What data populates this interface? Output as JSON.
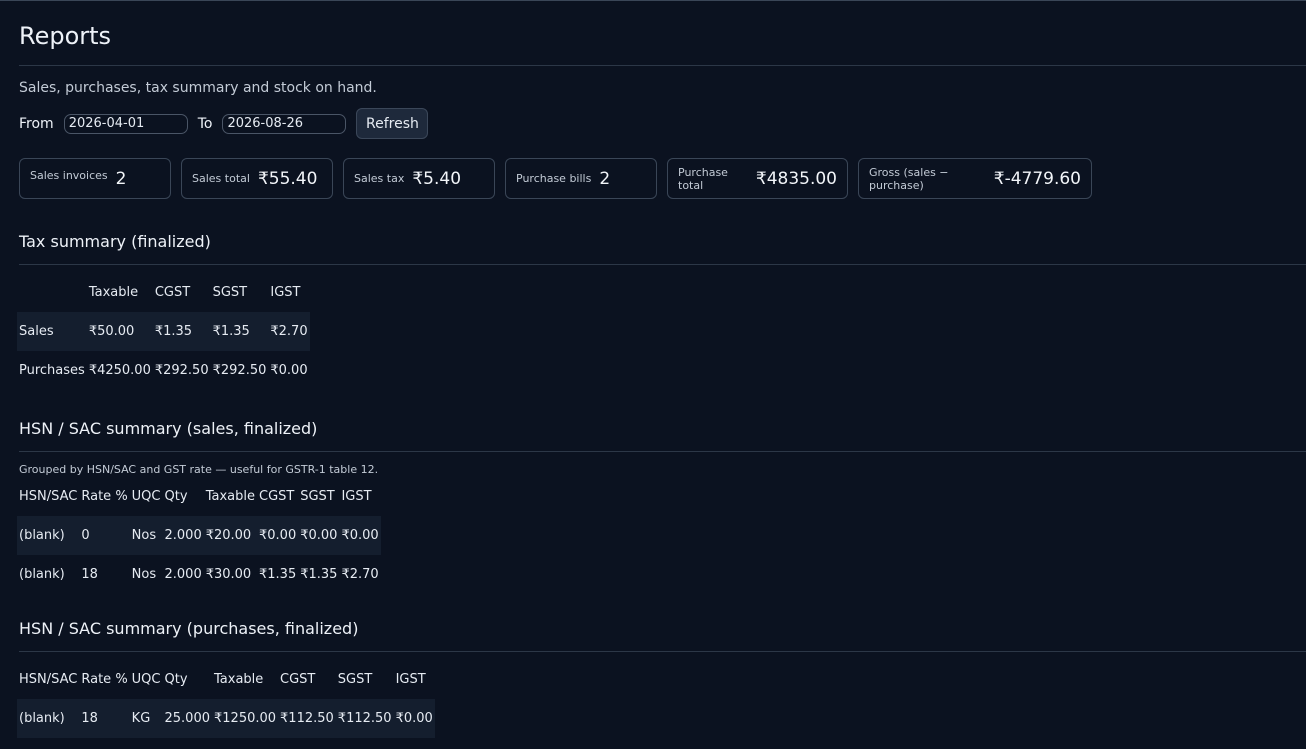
{
  "page": {
    "title": "Reports",
    "subtitle": "Sales, purchases, tax summary and stock on hand."
  },
  "filters": {
    "from_label": "From",
    "from_value": "2026-04-01",
    "to_label": "To",
    "to_value": "2026-08-26",
    "refresh_label": "Refresh"
  },
  "cards": [
    {
      "label": "Sales invoices",
      "value": "2"
    },
    {
      "label": "Sales total",
      "value": "₹55.40"
    },
    {
      "label": "Sales tax",
      "value": "₹5.40"
    },
    {
      "label": "Purchase bills",
      "value": "2"
    },
    {
      "label": "Purchase total",
      "value": "₹4835.00"
    },
    {
      "label": "Gross (sales − purchase)",
      "value": "₹-4779.60"
    }
  ],
  "tax_summary": {
    "title": "Tax summary (finalized)",
    "headers": [
      "",
      "Taxable",
      "CGST",
      "SGST",
      "IGST"
    ],
    "rows": [
      [
        "Sales",
        "₹50.00",
        "₹1.35",
        "₹1.35",
        "₹2.70"
      ],
      [
        "Purchases",
        "₹4250.00",
        "₹292.50",
        "₹292.50",
        "₹0.00"
      ]
    ]
  },
  "hsn_sales": {
    "title": "HSN / SAC summary (sales, finalized)",
    "note": "Grouped by HSN/SAC and GST rate — useful for GSTR-1 table 12.",
    "headers": [
      "HSN/SAC",
      "Rate %",
      "UQC",
      "Qty",
      "Taxable",
      "CGST",
      "SGST",
      "IGST"
    ],
    "rows": [
      [
        "(blank)",
        "0",
        "Nos",
        "2.000",
        "₹20.00",
        "₹0.00",
        "₹0.00",
        "₹0.00"
      ],
      [
        "(blank)",
        "18",
        "Nos",
        "2.000",
        "₹30.00",
        "₹1.35",
        "₹1.35",
        "₹2.70"
      ]
    ]
  },
  "hsn_purchases": {
    "title": "HSN / SAC summary (purchases, finalized)",
    "headers": [
      "HSN/SAC",
      "Rate %",
      "UQC",
      "Qty",
      "Taxable",
      "CGST",
      "SGST",
      "IGST"
    ],
    "rows": [
      [
        "(blank)",
        "18",
        "KG",
        "25.000",
        "₹1250.00",
        "₹112.50",
        "₹112.50",
        "₹0.00"
      ]
    ]
  }
}
